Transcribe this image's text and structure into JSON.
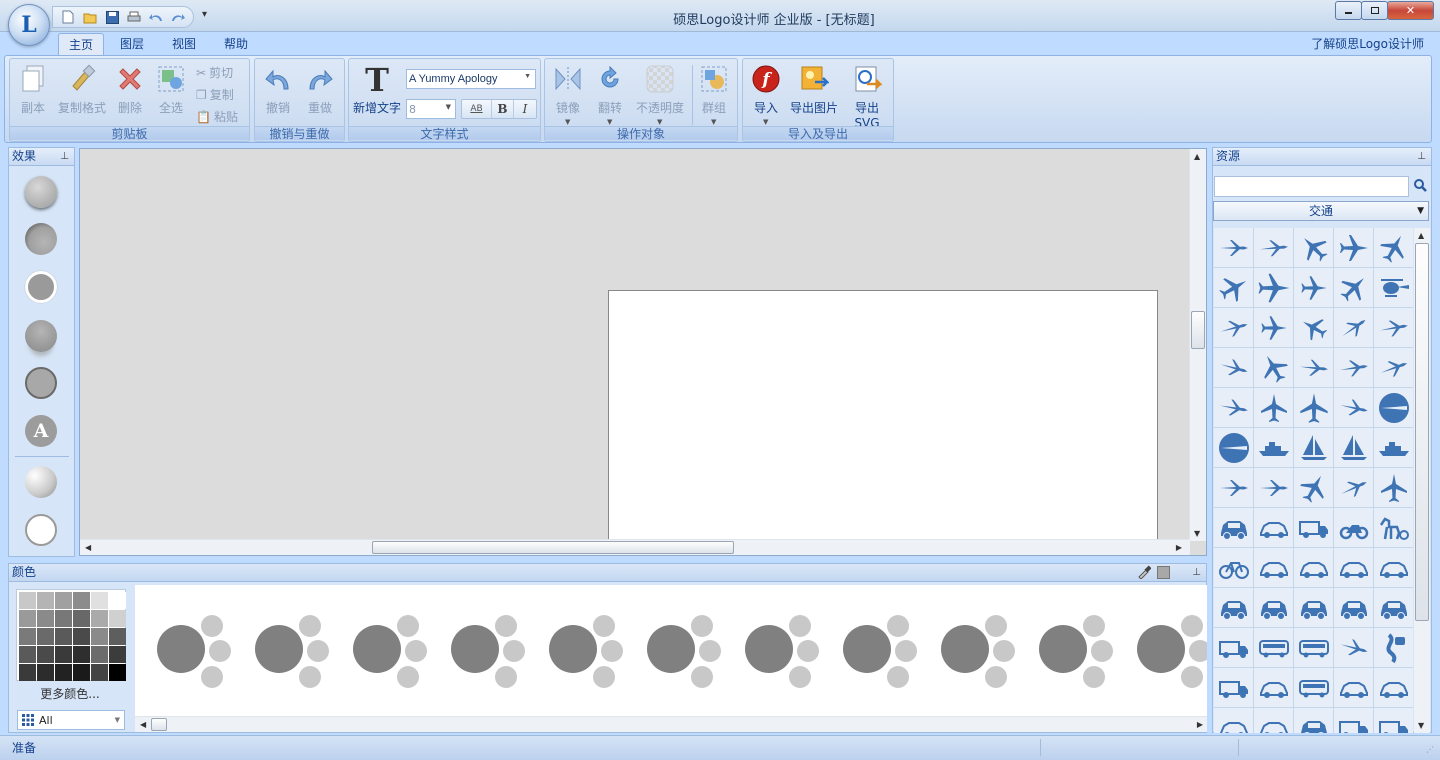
{
  "titlebar": {
    "title": "硕思Logo设计师 企业版 - [无标题]",
    "app_logo_letter": "L"
  },
  "quick_access": [
    "new-file-icon",
    "open-folder-icon",
    "save-icon",
    "print-icon",
    "undo-icon",
    "redo-icon"
  ],
  "tabs": [
    {
      "label": "主页",
      "active": true
    },
    {
      "label": "图层",
      "active": false
    },
    {
      "label": "视图",
      "active": false
    },
    {
      "label": "帮助",
      "active": false
    }
  ],
  "about_link": "了解硕思Logo设计师",
  "ribbon": {
    "clipboard": {
      "label": "剪贴板",
      "copy_instance": "副本",
      "format_painter": "复制格式",
      "delete": "删除",
      "select_all": "全选",
      "cut": "剪切",
      "copy": "复制",
      "paste": "粘贴"
    },
    "undo_redo": {
      "label": "撤销与重做",
      "undo": "撤销",
      "redo": "重做"
    },
    "text_style": {
      "label": "文字样式",
      "new_text": "新增文字",
      "font_name": "A Yummy Apology",
      "font_size": "8",
      "bold": "B",
      "italic": "I",
      "spacing": "AB"
    },
    "operate": {
      "label": "操作对象",
      "mirror": "镜像",
      "flip": "翻转",
      "opacity": "不透明度",
      "group": "群组"
    },
    "import_export": {
      "label": "导入及导出",
      "import": "导入",
      "export_image": "导出图片",
      "export_svg": "导出SVG"
    }
  },
  "effects_panel": {
    "title": "效果"
  },
  "colors_panel": {
    "title": "颜色",
    "more_colors": "更多颜色...",
    "palette": "All"
  },
  "resources_panel": {
    "title": "资源",
    "search_placeholder": "",
    "category": "交通"
  },
  "status": {
    "text": "准备"
  },
  "colors": {
    "accent": "#15428b",
    "icon_blue": "#3f74b4",
    "gray_dot": "#808080",
    "light_dot": "#c8c8c8"
  }
}
